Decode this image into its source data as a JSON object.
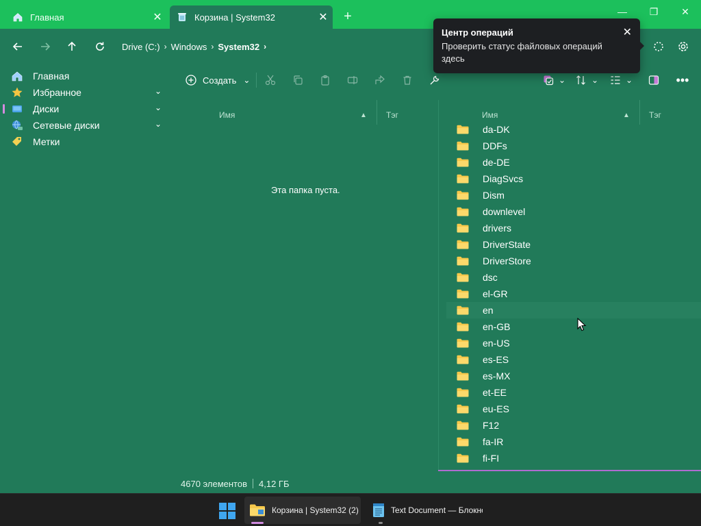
{
  "tabs": [
    {
      "label": "Главная",
      "icon": "home-icon",
      "close": "✕"
    },
    {
      "label": "Корзина | System32",
      "icon": "recycle-bin-icon",
      "close": "✕"
    }
  ],
  "window_controls": {
    "new_tab": "+",
    "minimize": "—",
    "maximize": "❐",
    "close": "✕"
  },
  "nav": {
    "back": "back-arrow-icon",
    "forward": "forward-arrow-icon",
    "up": "up-arrow-icon",
    "refresh": "refresh-icon"
  },
  "breadcrumb": [
    "Drive (C:)",
    "Windows",
    "System32"
  ],
  "sidebar": [
    {
      "label": "Главная",
      "icon": "home-icon",
      "expandable": false
    },
    {
      "label": "Избранное",
      "icon": "star-icon",
      "expandable": true
    },
    {
      "label": "Диски",
      "icon": "drive-icon",
      "expandable": true,
      "selected": true
    },
    {
      "label": "Сетевые диски",
      "icon": "network-drive-icon",
      "expandable": true
    },
    {
      "label": "Метки",
      "icon": "tag-icon",
      "expandable": false
    }
  ],
  "toolbar": {
    "create_label": "Создать"
  },
  "columns": {
    "name": "Имя",
    "tag": "Тэг"
  },
  "left_pane": {
    "empty_message": "Эта папка пуста."
  },
  "right_pane": {
    "items": [
      "da-DK",
      "DDFs",
      "de-DE",
      "DiagSvcs",
      "Dism",
      "downlevel",
      "drivers",
      "DriverState",
      "DriverStore",
      "dsc",
      "el-GR",
      "en",
      "en-GB",
      "en-US",
      "es-ES",
      "es-MX",
      "et-EE",
      "eu-ES",
      "F12",
      "fa-IR",
      "fi-FI"
    ],
    "hover_item": "en"
  },
  "status": {
    "count": "4670 элементов",
    "size": "4,12 ГБ"
  },
  "toast": {
    "title": "Центр операций",
    "body": "Проверить статус файловых операций здесь",
    "close": "✕"
  },
  "taskbar": [
    {
      "label": "Корзина | System32 (2)",
      "icon": "file-explorer-icon",
      "active": true
    },
    {
      "label": "Text Document — Блокнот",
      "icon": "notepad-icon",
      "active": false
    }
  ],
  "colors": {
    "background": "#217a59",
    "titlebar": "#1cc05c",
    "accent": "#b06cd0",
    "folder": "#f6c84b",
    "toast_bg": "#1d1f22",
    "taskbar_bg": "#1f1f1f"
  }
}
